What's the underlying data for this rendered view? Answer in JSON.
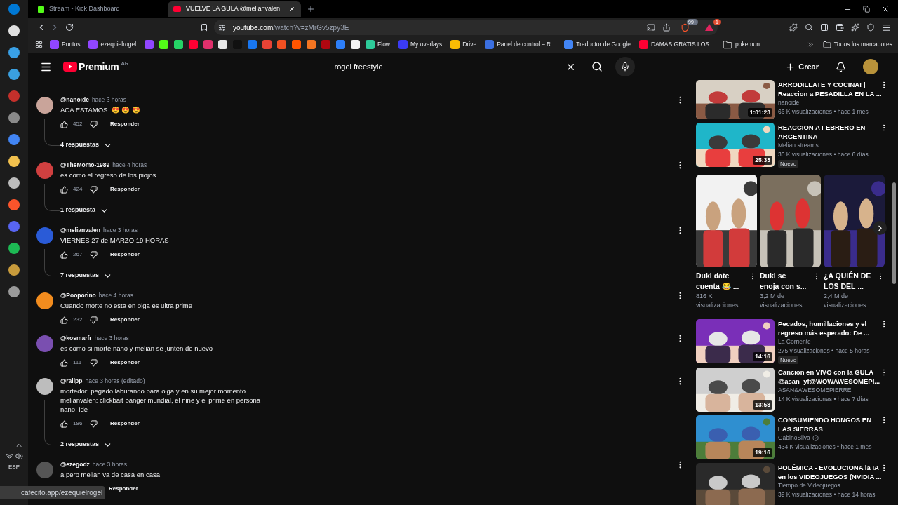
{
  "taskbar": {
    "language": "ESP"
  },
  "browser": {
    "tabs": [
      {
        "title": "Stream - Kick Dashboard",
        "selected": false,
        "kind": "kick"
      },
      {
        "title": "VUELVE LA GULA @melianvalen",
        "selected": true,
        "kind": "youtube"
      }
    ],
    "url_host": "youtube.com",
    "url_path": "/watch?v=zMrGv5zpy3E",
    "shield_badge": "99+",
    "alert_badge": "1",
    "bookmarks": [
      {
        "label": "Puntos",
        "color": "#9146ff",
        "kind": "site"
      },
      {
        "label": "ezequielrogel",
        "color": "#9146ff",
        "kind": "site"
      },
      {
        "color": "#9146ff",
        "kind": "site"
      },
      {
        "color": "#53fc18",
        "kind": "site"
      },
      {
        "color": "#25d366",
        "kind": "site"
      },
      {
        "color": "#ff0033",
        "kind": "site"
      },
      {
        "color": "#e1306c",
        "kind": "site"
      },
      {
        "color": "#e8e8e8",
        "kind": "site"
      },
      {
        "color": "#111111",
        "kind": "site"
      },
      {
        "color": "#1877f2",
        "kind": "site"
      },
      {
        "color": "#ea4335",
        "kind": "site"
      },
      {
        "color": "#f25022",
        "kind": "site"
      },
      {
        "color": "#ff5500",
        "kind": "site"
      },
      {
        "color": "#f47521",
        "kind": "site"
      },
      {
        "color": "#b00710",
        "kind": "site"
      },
      {
        "color": "#2d7ff9",
        "kind": "site"
      },
      {
        "color": "#f2f2f2",
        "kind": "site"
      },
      {
        "label": "Flow",
        "color": "#2ecc9a",
        "kind": "site"
      },
      {
        "label": "My overlays",
        "color": "#3b3bf5",
        "kind": "site"
      },
      {
        "label": "Drive",
        "color": "#fbbc04",
        "kind": "site"
      },
      {
        "label": "Panel de control – R...",
        "color": "#3b6fe0",
        "kind": "site"
      },
      {
        "label": "Traductor de Google",
        "color": "#4285f4",
        "kind": "site"
      },
      {
        "label": "DAMAS GRATIS LOS...",
        "color": "#ff0033",
        "kind": "site"
      },
      {
        "label": "pokemon",
        "color": "#c8c8c8",
        "kind": "folder"
      }
    ],
    "all_bookmarks": "Todos los marcadores"
  },
  "youtube": {
    "logo": "Premium",
    "region": "AR",
    "search": "rogel freestyle",
    "create": "Crear"
  },
  "comments": [
    {
      "user": "@nanoide",
      "time": "hace 3 horas",
      "lines": [
        "ACA ESTAMOS. 😍 😍 😍"
      ],
      "likes": "452",
      "reply": "Responder",
      "replies": "4 respuestas",
      "color": "#c9a49a"
    },
    {
      "user": "@TheMomo-1989",
      "time": "hace 4 horas",
      "lines": [
        "es como el regreso de los piojos"
      ],
      "likes": "424",
      "reply": "Responder",
      "replies": "1 respuesta",
      "color": "#d04040"
    },
    {
      "user": "@melianvalen",
      "time": "hace 3 horas",
      "lines": [
        "VIERNES 27 de MARZO 19 HORAS"
      ],
      "likes": "267",
      "reply": "Responder",
      "replies": "7 respuestas",
      "color": "#2a5bd7"
    },
    {
      "user": "@Pooporino",
      "time": "hace 4 horas",
      "lines": [
        "Cuando morte no esta en olga es ultra prime"
      ],
      "likes": "232",
      "reply": "Responder",
      "color": "#f28c1e"
    },
    {
      "user": "@kosmarfr",
      "time": "hace 3 horas",
      "lines": [
        "es como si morte nano y melian se junten de nuevo"
      ],
      "likes": "111",
      "reply": "Responder",
      "color": "#7a4fb0"
    },
    {
      "user": "@ralipp",
      "time": "hace 3 horas (editado)",
      "lines": [
        "mortedor: pegado laburando para olga y en su mejor momento",
        "melianvalen: clickbait banger mundial, el nine y el prime en persona",
        "nano: ide"
      ],
      "likes": "186",
      "reply": "Responder",
      "replies": "2 respuestas",
      "color": "#bdbdbd"
    },
    {
      "user": "@ezegodz",
      "time": "hace 3 horas",
      "lines": [
        "a pero melian va de casa en casa"
      ],
      "reply": "Responder",
      "color": "#555555"
    }
  ],
  "sidebar": [
    {
      "kind": "video",
      "title_lines": [
        "ARRODILLATE Y COCINA! |",
        "Reaccion a PESADILLA EN LA ..."
      ],
      "channel": "nanoide",
      "verified": false,
      "meta": "66 K visualizaciones • hace 1 mes",
      "duration": "1:01:23"
    },
    {
      "kind": "video",
      "title_lines": [
        "REACCION A FEBRERO EN",
        "ARGENTINA"
      ],
      "channel": "Melian streams",
      "verified": false,
      "meta": "30 K visualizaciones • hace 6 días",
      "duration": "25:33",
      "badge": "Nuevo"
    },
    {
      "kind": "shorts",
      "items": [
        {
          "title_lines": [
            "Duki date",
            "cuenta 😂 ..."
          ],
          "view_lines": [
            "816 K",
            "visualizaciones"
          ]
        },
        {
          "title_lines": [
            "Duki se",
            "enoja con s..."
          ],
          "view_lines": [
            "3,2 M de",
            "visualizaciones"
          ]
        },
        {
          "title_lines": [
            "¿A QUIÉN DE",
            "LOS DEL ..."
          ],
          "view_lines": [
            "2,4 M de",
            "visualizaciones"
          ]
        }
      ]
    },
    {
      "kind": "video",
      "title_lines": [
        "Pecados, humillaciones y el",
        "regreso más esperado: De ..."
      ],
      "channel": "La Corriente",
      "verified": false,
      "meta": "275 visualizaciones • hace 5 horas",
      "duration": "14:16",
      "badge": "Nuevo"
    },
    {
      "kind": "video",
      "title_lines": [
        "Cancion en VIVO con la GULA",
        "@asan_yf@WOWAWESOMEPI..."
      ],
      "channel": "ASAN&AWESOMEPIERRE",
      "verified": false,
      "meta": "14 K visualizaciones • hace 7 días",
      "duration": "13:58"
    },
    {
      "kind": "video",
      "title_lines": [
        "CONSUMIENDO HONGOS EN",
        "LAS SIERRAS"
      ],
      "channel": "GabinoSilva",
      "verified": true,
      "meta": "434 K visualizaciones • hace 1 mes",
      "duration": "19:16"
    },
    {
      "kind": "video",
      "title_lines": [
        "POLÉMICA - EVOLUCIONA la IA",
        "en los VIDEOJUEGOS (NVIDIA ..."
      ],
      "channel": "Tiempo de Videojuegos",
      "verified": false,
      "meta": "39 K visualizaciones • hace 14 horas"
    }
  ],
  "status_link": "cafecito.app/ezequielrogel"
}
